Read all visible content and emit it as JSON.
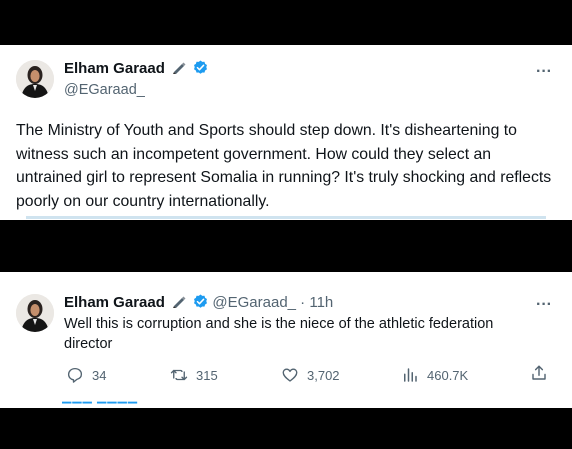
{
  "tweet": {
    "author_name": "Elham Garaad",
    "author_handle": "@EGaraad_",
    "text": "The Ministry of Youth and Sports should step down. It's disheartening to witness such an incompetent government. How could they select an untrained girl to represent Somalia in running? It's truly shocking and reflects poorly on our country internationally.",
    "more_glyph": "···"
  },
  "reply": {
    "author_name": "Elham Garaad",
    "author_handle": "@EGaraad_",
    "time_separator": " · ",
    "time": "11h",
    "text": "Well this is corruption and she is the niece of the athletic federation director",
    "more_glyph": "···",
    "stats": {
      "replies": "34",
      "reposts": "315",
      "likes": "3,702",
      "views": "460.7K"
    }
  },
  "icons": {
    "verified": "verified-badge-icon",
    "pen": "pen-emoji-icon",
    "reply": "reply-icon",
    "repost": "repost-icon",
    "like": "heart-icon",
    "views": "views-chart-icon",
    "share": "share-icon"
  },
  "colors": {
    "verified_blue": "#1d9bf0",
    "text": "#0f1419",
    "muted": "#536471",
    "background_bars": "#000000"
  }
}
